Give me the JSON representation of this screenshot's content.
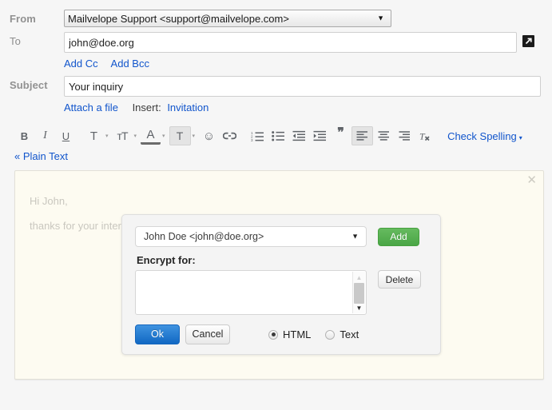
{
  "compose": {
    "from": {
      "label": "From",
      "value": "Mailvelope Support <support@mailvelope.com>",
      "options": [
        "Mailvelope Support <support@mailvelope.com>"
      ]
    },
    "to": {
      "label": "To",
      "value": "john@doe.org",
      "placeholder": "",
      "popout_icon": "external-link-icon"
    },
    "add_cc": "Add Cc",
    "add_bcc": "Add Bcc",
    "subject": {
      "label": "Subject",
      "value": "Your inquiry",
      "placeholder": ""
    },
    "attach_file": "Attach a file",
    "insert_label": "Insert:",
    "insert_invitation": "Invitation",
    "plain_text": "« Plain Text"
  },
  "toolbar": {
    "bold": "B",
    "italic": "I",
    "underline": "U",
    "font_family": "T",
    "font_size": "тT",
    "text_color": "A",
    "highlight_color": "T",
    "emoji": "☺",
    "link": "link-icon",
    "numbered_list": "numbered-list-icon",
    "bullet_list": "bullet-list-icon",
    "outdent": "outdent-icon",
    "indent": "indent-icon",
    "quote": "❞",
    "align_left": "align-left-icon",
    "align_center": "align-center-icon",
    "align_right": "align-right-icon",
    "remove_formatting": "Tx",
    "check_spelling": "Check Spelling",
    "caret": "▾"
  },
  "body": {
    "line1": "Hi John,",
    "line2": "thanks for your interest",
    "close": "✕"
  },
  "dialog": {
    "recipient": {
      "value": "John Doe <john@doe.org>",
      "options": [
        "John Doe <john@doe.org>"
      ]
    },
    "add_button": "Add",
    "encrypt_for_label": "Encrypt for:",
    "encrypt_list": [],
    "delete_button": "Delete",
    "ok_button": "Ok",
    "cancel_button": "Cancel",
    "format_options": [
      {
        "label": "HTML",
        "selected": true
      },
      {
        "label": "Text",
        "selected": false
      }
    ],
    "scroll_up": "▲",
    "scroll_down": "▼",
    "caret": "▼"
  },
  "colors": {
    "link": "#1155cc",
    "add_button": "#4aa646",
    "ok_button": "#1168c3",
    "body_background": "#fdfbf1",
    "page_background": "#f6f6f6"
  }
}
